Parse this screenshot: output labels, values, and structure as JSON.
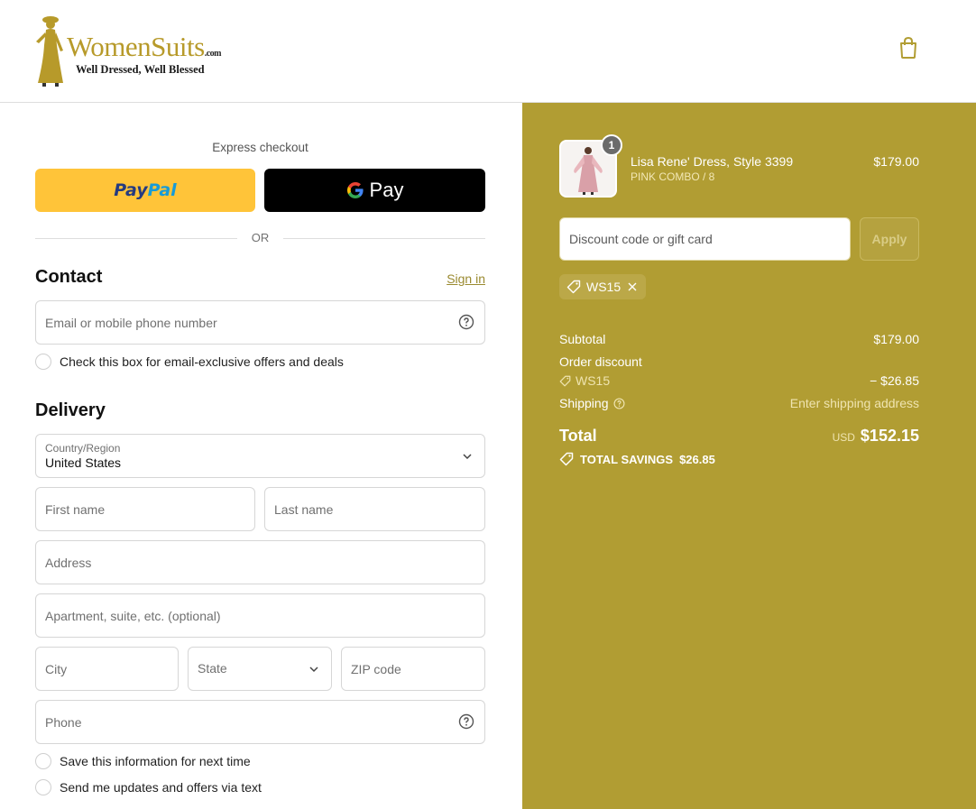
{
  "header": {
    "logo_name": "WomenSuits",
    "logo_suffix": ".com",
    "logo_tagline": "Well Dressed, Well Blessed"
  },
  "express": {
    "label": "Express checkout",
    "paypal_part1": "Pay",
    "paypal_part2": "Pal",
    "gpay_label": "Pay",
    "or_label": "OR"
  },
  "contact": {
    "title": "Contact",
    "signin_label": "Sign in",
    "email_placeholder": "Email or mobile phone number",
    "offers_checkbox": "Check this box for email-exclusive offers and deals"
  },
  "delivery": {
    "title": "Delivery",
    "country_label": "Country/Region",
    "country_value": "United States",
    "first_name": "First name",
    "last_name": "Last name",
    "address": "Address",
    "apartment": "Apartment, suite, etc. (optional)",
    "city": "City",
    "state": "State",
    "zip": "ZIP code",
    "phone": "Phone",
    "save_info": "Save this information for next time",
    "text_updates": "Send me updates and offers via text"
  },
  "order": {
    "item": {
      "quantity": "1",
      "name": "Lisa Rene' Dress, Style 3399",
      "variant": "PINK COMBO / 8",
      "price": "$179.00"
    },
    "discount_placeholder": "Discount code or gift card",
    "apply_label": "Apply",
    "applied_code": "WS15",
    "subtotal_label": "Subtotal",
    "subtotal_value": "$179.00",
    "order_discount_label": "Order discount",
    "discount_code": "WS15",
    "discount_value": "− $26.85",
    "shipping_label": "Shipping",
    "shipping_value": "Enter shipping address",
    "total_label": "Total",
    "currency": "USD",
    "total_value": "$152.15",
    "savings_label": "TOTAL SAVINGS",
    "savings_value": "$26.85"
  },
  "colors": {
    "sidebar_bg": "#b19d33",
    "paypal_yellow": "#ffc439",
    "brand_gold": "#b79a2a"
  }
}
